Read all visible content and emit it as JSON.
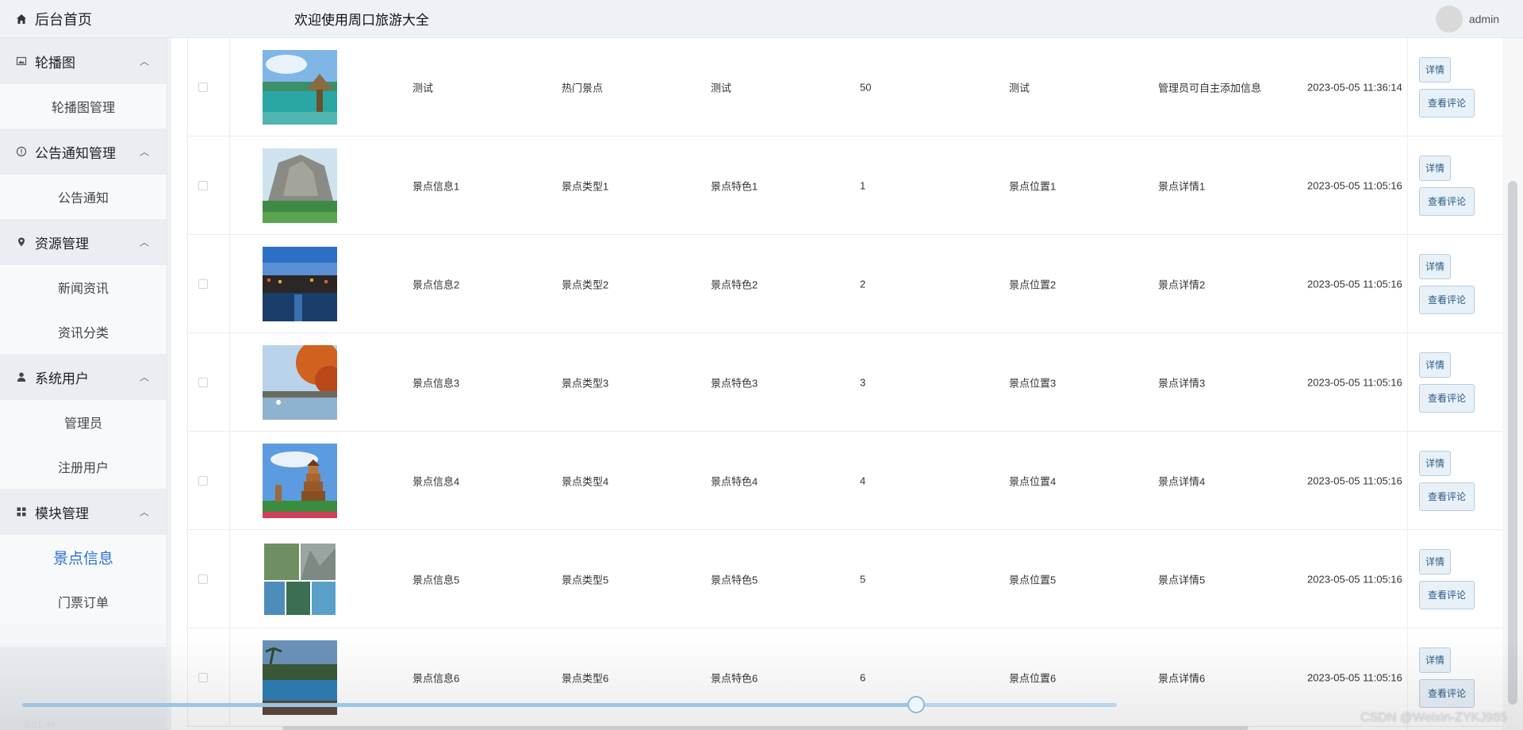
{
  "header": {
    "home_label": "后台首页",
    "site_title": "欢迎使用周口旅游大全",
    "user_name": "admin"
  },
  "sidebar": {
    "groups": [
      {
        "title": "轮播图",
        "icon": "image-icon",
        "items": [
          "轮播图管理"
        ]
      },
      {
        "title": "公告通知管理",
        "icon": "info-icon",
        "items": [
          "公告通知"
        ]
      },
      {
        "title": "资源管理",
        "icon": "location-pin-icon",
        "items": [
          "新闻资讯",
          "资讯分类"
        ]
      },
      {
        "title": "系统用户",
        "icon": "user-icon",
        "items": [
          "管理员",
          "注册用户"
        ]
      },
      {
        "title": "模块管理",
        "icon": "grid-icon",
        "items": [
          "景点信息",
          "门票订单"
        ],
        "active_item": "景点信息"
      }
    ]
  },
  "table": {
    "rows": [
      {
        "name": "测试",
        "type": "热门景点",
        "feature": "测试",
        "num": "50",
        "location": "测试",
        "detail": "管理员可自主添加信息",
        "time": "2023-05-05 11:36:14",
        "image": "tropical-lake-photo"
      },
      {
        "name": "景点信息1",
        "type": "景点类型1",
        "feature": "景点特色1",
        "num": "1",
        "location": "景点位置1",
        "detail": "景点详情1",
        "time": "2023-05-05 11:05:16",
        "image": "mountain-cliff-photo"
      },
      {
        "name": "景点信息2",
        "type": "景点类型2",
        "feature": "景点特色2",
        "num": "2",
        "location": "景点位置2",
        "detail": "景点详情2",
        "time": "2023-05-05 11:05:16",
        "image": "water-town-night-photo"
      },
      {
        "name": "景点信息3",
        "type": "景点类型3",
        "feature": "景点特色3",
        "num": "3",
        "location": "景点位置3",
        "detail": "景点详情3",
        "time": "2023-05-05 11:05:16",
        "image": "autumn-lake-photo"
      },
      {
        "name": "景点信息4",
        "type": "景点类型4",
        "feature": "景点特色4",
        "num": "4",
        "location": "景点位置4",
        "detail": "景点详情4",
        "time": "2023-05-05 11:05:16",
        "image": "pagoda-photo"
      },
      {
        "name": "景点信息5",
        "type": "景点类型5",
        "feature": "景点特色5",
        "num": "5",
        "location": "景点位置5",
        "detail": "景点详情5",
        "time": "2023-05-05 11:05:16",
        "image": "canyon-collage-photo"
      },
      {
        "name": "景点信息6",
        "type": "景点类型6",
        "feature": "景点特色6",
        "num": "6",
        "location": "景点位置6",
        "detail": "景点详情6",
        "time": "2023-05-05 11:05:16",
        "image": "resort-pool-photo"
      }
    ],
    "detail_button": "详情",
    "comment_button": "查看评论"
  },
  "player": {
    "elapsed": "0:01:49",
    "progress": 0.817
  },
  "watermark": "CSDN @Weixin-ZYKJ985",
  "colors": {
    "accent": "#2f6fd0",
    "button_bg": "#e8f1f8",
    "button_border": "#b8cde0"
  }
}
